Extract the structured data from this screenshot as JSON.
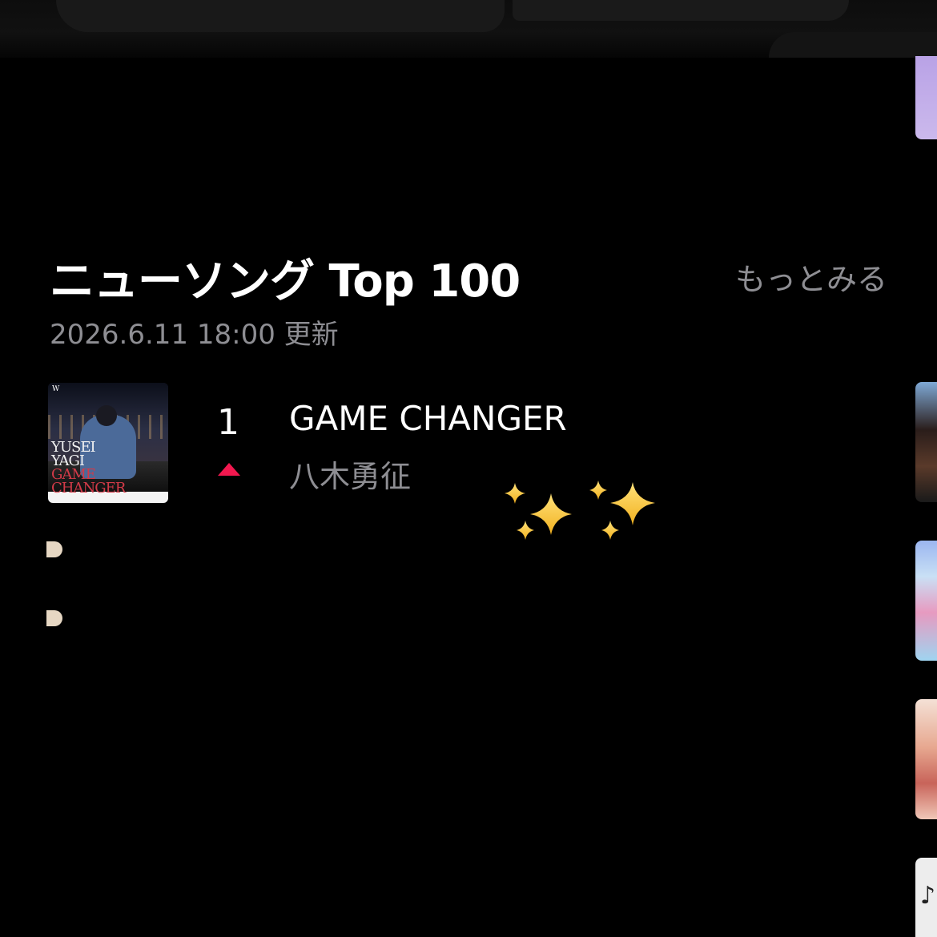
{
  "section": {
    "title": "ニューソング Top 100",
    "more_label": "もっとみる",
    "updated": "2026.6.11 18:00 更新"
  },
  "entries": [
    {
      "rank": "1",
      "movement": "up",
      "title": "GAME CHANGER",
      "artist": "八木勇征",
      "artwork_text": [
        "YUSEI",
        "YAGI",
        "GAME",
        "CHANGER"
      ],
      "artwork_label": "W"
    }
  ],
  "decoration": {
    "emoji": "sparkles-emoji"
  },
  "colors": {
    "background": "#000000",
    "primary_text": "#ffffff",
    "secondary_text": "#8e8e93",
    "rank_up": "#f2184f",
    "sparkle": "#f6c744"
  }
}
